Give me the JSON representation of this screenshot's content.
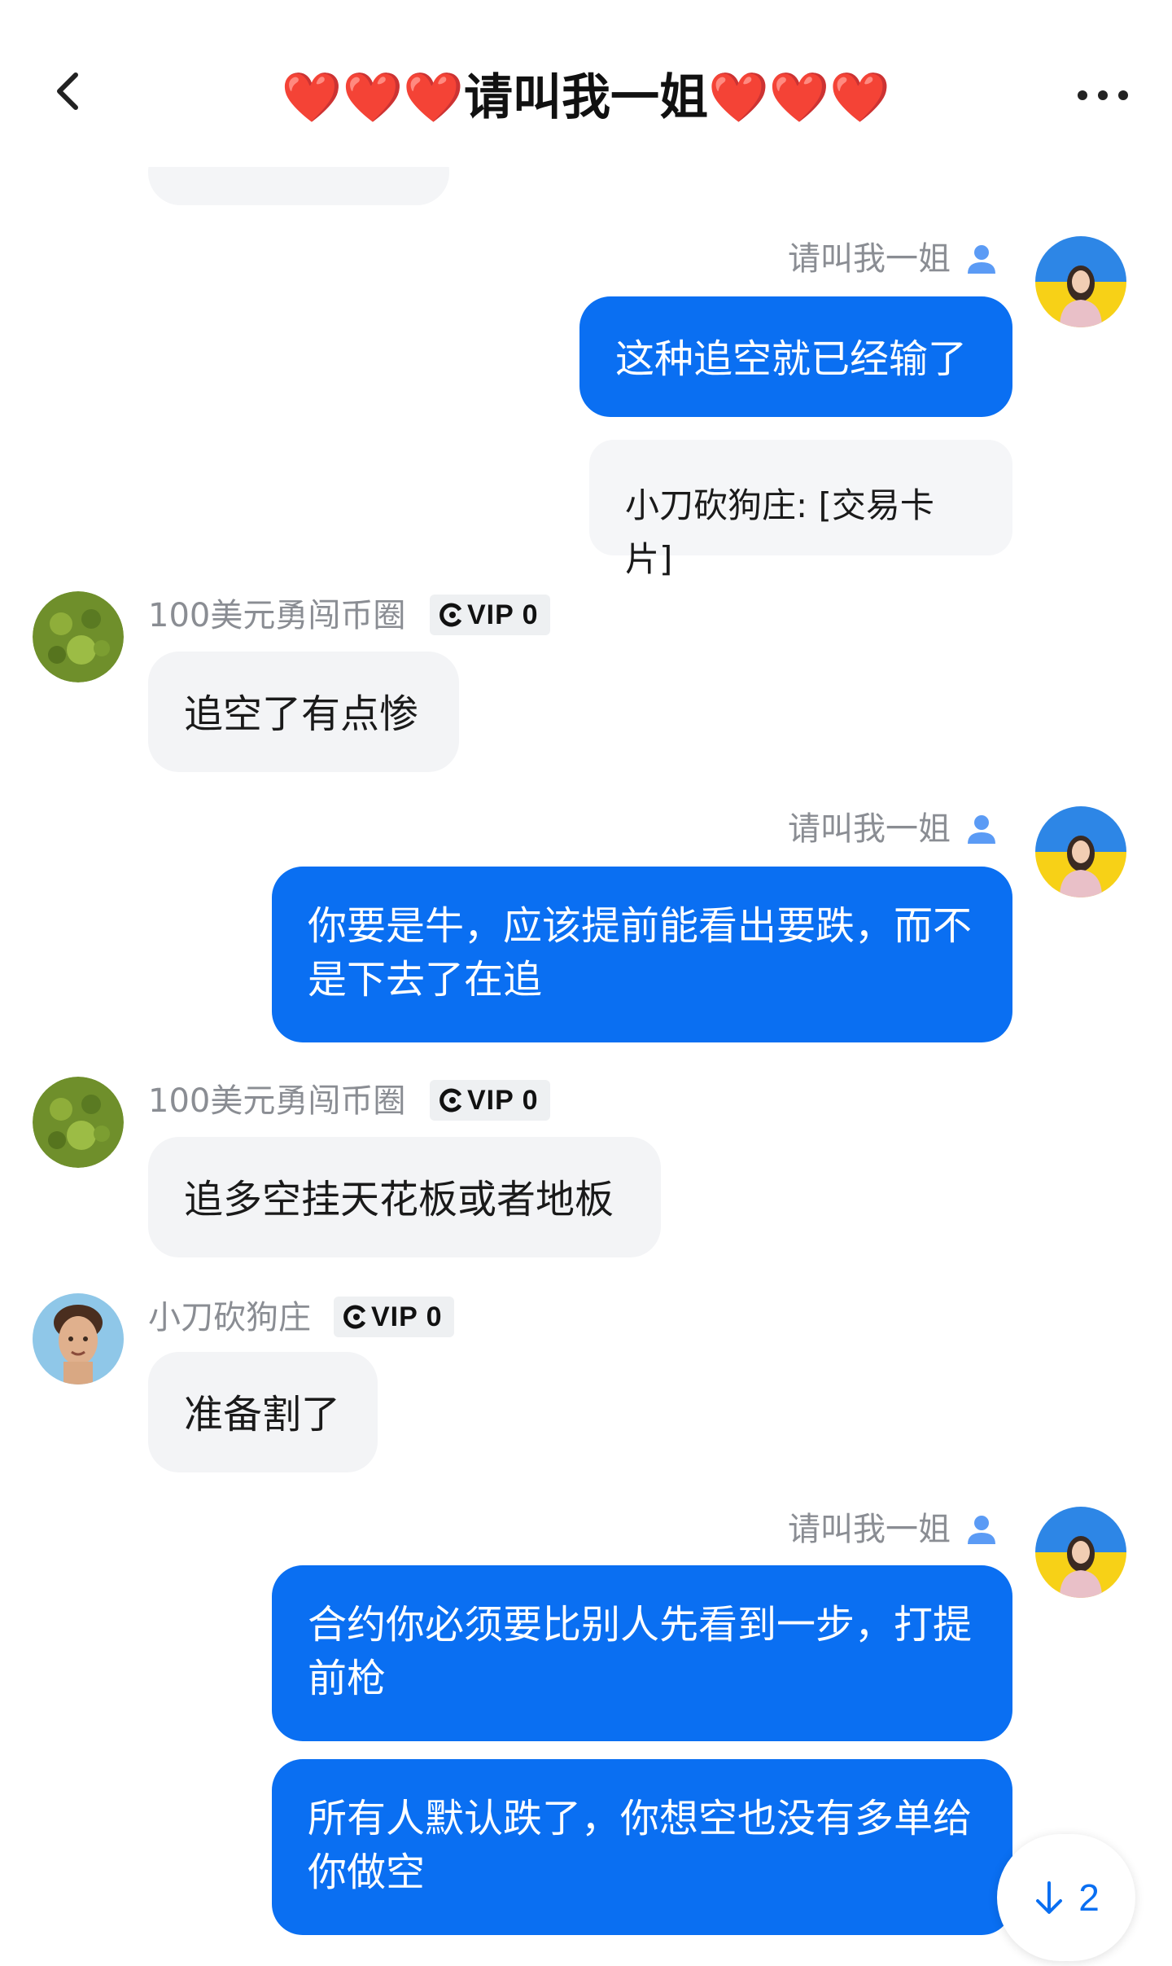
{
  "header": {
    "title": "❤️❤️❤️请叫我一姐❤️❤️❤️"
  },
  "messages": [
    {
      "sender": "请叫我一姐",
      "text": "这种追空就已经输了"
    },
    {
      "card": "小刀砍狗庄: [交易卡片]"
    },
    {
      "sender": "100美元勇闯币圈",
      "vip": "VIP 0",
      "text": "追空了有点惨"
    },
    {
      "sender": "请叫我一姐",
      "text": "你要是牛，应该提前能看出要跌，而不是下去了在追"
    },
    {
      "sender": "100美元勇闯币圈",
      "vip": "VIP 0",
      "text": "追多空挂天花板或者地板"
    },
    {
      "sender": "小刀砍狗庄",
      "vip": "VIP 0",
      "text": "准备割了"
    },
    {
      "sender": "请叫我一姐",
      "text": "合约你必须要比别人先看到一步，打提前枪"
    },
    {
      "text": "所有人默认跌了，你想空也没有多单给你做空"
    }
  ],
  "scroll_button": {
    "count": "2"
  },
  "colors": {
    "accent": "#0a6ff2",
    "incoming_bubble": "#f3f4f6",
    "muted_text": "#8a8d93"
  },
  "icons": [
    "back-chevron-icon",
    "more-dots-icon",
    "person-icon",
    "vip-swirl-icon",
    "arrow-down-icon"
  ]
}
